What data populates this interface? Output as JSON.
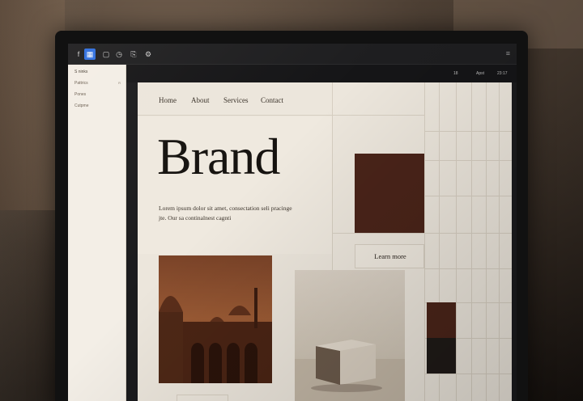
{
  "editor": {
    "toolbar": {
      "tools": [
        "f",
        "▦",
        "▢",
        "◷",
        "⎘",
        "⚙"
      ],
      "menu_icon": "≡"
    },
    "canvas_bar": {
      "zoom": "18",
      "action": "Apst",
      "status": "23:17"
    },
    "left_panel": {
      "heading": "S ninks",
      "items": [
        {
          "label": "Pattrics",
          "badge": "R"
        },
        {
          "label": "Pones"
        },
        {
          "label": "Cutpme"
        }
      ]
    }
  },
  "site": {
    "nav": [
      "Home",
      "About",
      "Services",
      "Contact"
    ],
    "hero_title": "Brand",
    "hero_text": "Lorem ipsum dolor sit amet, consectation seli pracinge jte. Our sa continalnest cagnti",
    "cta_label": "Learn more"
  },
  "colors": {
    "accent_brown": "#4a2419",
    "dark_swatch": "#1f1a17",
    "page_bg": "#ece6dc",
    "editor_active": "#2f6fe0"
  }
}
